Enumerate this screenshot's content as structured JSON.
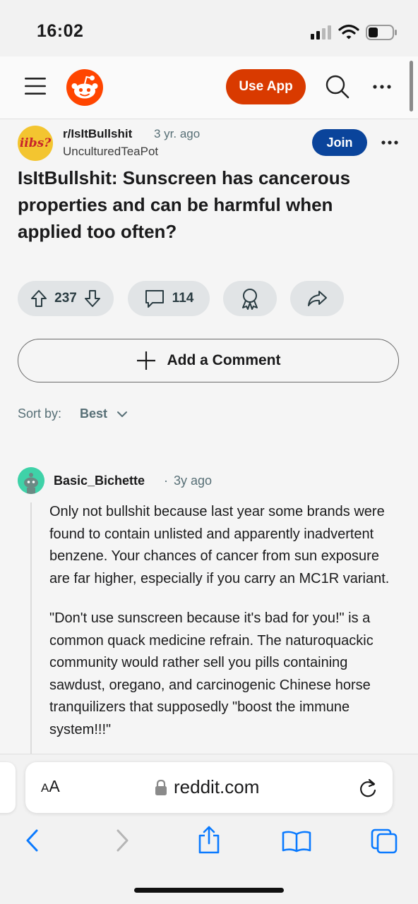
{
  "status_bar": {
    "time": "16:02"
  },
  "header": {
    "use_app_label": "Use App"
  },
  "post": {
    "subreddit_icon_text": "iibs?",
    "subreddit": "r/IsItBullshit",
    "age": "3 yr. ago",
    "author": "UnculturedTeaPot",
    "join_label": "Join",
    "title": "IsItBullshit: Sunscreen has cancerous properties and can be harmful when applied too often?",
    "votes": "237",
    "comments": "114"
  },
  "add_comment_label": "Add a Comment",
  "sort": {
    "label": "Sort by:",
    "value": "Best"
  },
  "comment": {
    "author": "Basic_Bichette",
    "dot": "·",
    "age": "3y ago",
    "paragraphs": [
      "Only not bullshit because last year some brands were found to contain unlisted and apparently inadvertent benzene. Your chances of cancer from sun exposure are far higher, especially if you carry an MC1R variant.",
      "\"Don't use sunscreen because it's bad for you!\" is a common quack medicine refrain. The naturoquackic community would rather sell you pills containing sawdust, oregano, and carcinogenic Chinese horse tranquilizers that supposedly \"boost the immune system!!!\""
    ]
  },
  "browser": {
    "aa_label_big": "A",
    "aa_label_small": "A",
    "domain": "reddit.com"
  },
  "colors": {
    "reddit_orange": "#ff4500",
    "use_app_bg": "#d93a00",
    "join_bg": "#0a449b",
    "safari_blue": "#0a7aff"
  },
  "icons": [
    "signal-icon",
    "wifi-icon",
    "battery-icon",
    "menu-icon",
    "reddit-logo",
    "search-icon",
    "more-icon",
    "upvote-icon",
    "downvote-icon",
    "comment-icon",
    "award-icon",
    "share-icon",
    "plus-icon",
    "chevron-down-icon",
    "lock-icon",
    "reload-icon",
    "back-icon",
    "forward-icon",
    "share-sheet-icon",
    "bookmarks-icon",
    "tabs-icon"
  ]
}
